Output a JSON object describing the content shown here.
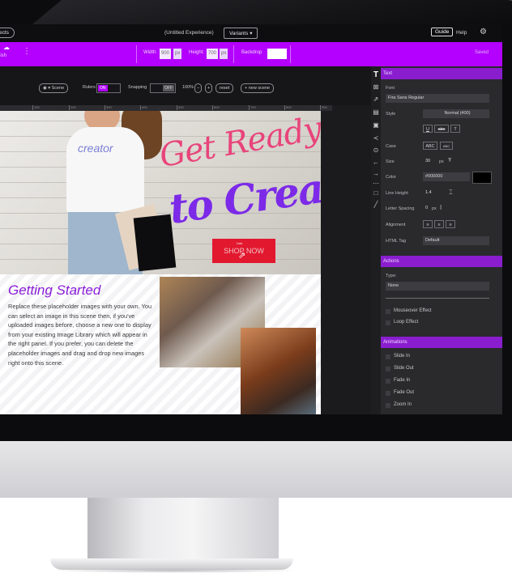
{
  "topbar": {
    "projects": "ects",
    "title": "(Untitled Experience)",
    "variants": "Variants",
    "guide": "Guide",
    "help": "Help"
  },
  "purplebar": {
    "publish": "lish",
    "width_label": "Width:",
    "width_value": "900",
    "width_unit": "px",
    "height_label": "Height:",
    "height_value": "700",
    "height_unit": "px",
    "backdrop": "Backdrop",
    "saved": "Saved",
    "accent": "#b300ff"
  },
  "toolbar": {
    "scene": "Scene",
    "rulers": "Rulers",
    "rulers_state": "ON",
    "snapping": "Snapping",
    "snapping_state": "OFF",
    "zoom": "100%",
    "zoom_out": "−",
    "zoom_in": "+",
    "reset": "reset",
    "new_scene": "+ new scene"
  },
  "ruler": [
    "100",
    "200",
    "300",
    "400",
    "500",
    "600",
    "700",
    "800",
    "900"
  ],
  "canvas": {
    "shirt_brand": "creator",
    "headline1": "Get Ready",
    "headline2": "to Create!",
    "shop_link": "Link",
    "shop_button": "SHOP NOW",
    "heading": "Getting Started",
    "body": "Replace these placeholder images with your own. You can select an image in this scene then, if you've uploaded images before, choose a new one to display from your existing Image Library which will appear in the right panel. If you prefer, you can delete the placeholder images and drag and drop new images right onto this scene."
  },
  "panel": {
    "text_section": "Text",
    "font_label": "Font",
    "font_value": "Fira Sans Regular",
    "style_label": "Style",
    "style_value": "Normal (400)",
    "case_label": "Case",
    "case_upper": "ABC",
    "case_small": "ABC",
    "size_label": "Size",
    "size_value": "30",
    "size_unit": "px",
    "color_label": "Color",
    "color_value": "#000000",
    "line_height_label": "Line Height",
    "line_height_value": "1.4",
    "letter_spacing_label": "Letter Spacing",
    "letter_spacing_value": "0",
    "letter_spacing_unit": "px",
    "alignment_label": "Alignment",
    "html_tag_label": "HTML Tag",
    "html_tag_value": "Default",
    "actions_section": "Actions",
    "type_label": "Type:",
    "type_value": "None",
    "mouseover": "Mouseover Effect",
    "loop": "Loop Effect",
    "animations_section": "Animations",
    "animations": [
      "Slide In",
      "Slide Out",
      "Fade In",
      "Fade Out",
      "Zoom In"
    ]
  }
}
